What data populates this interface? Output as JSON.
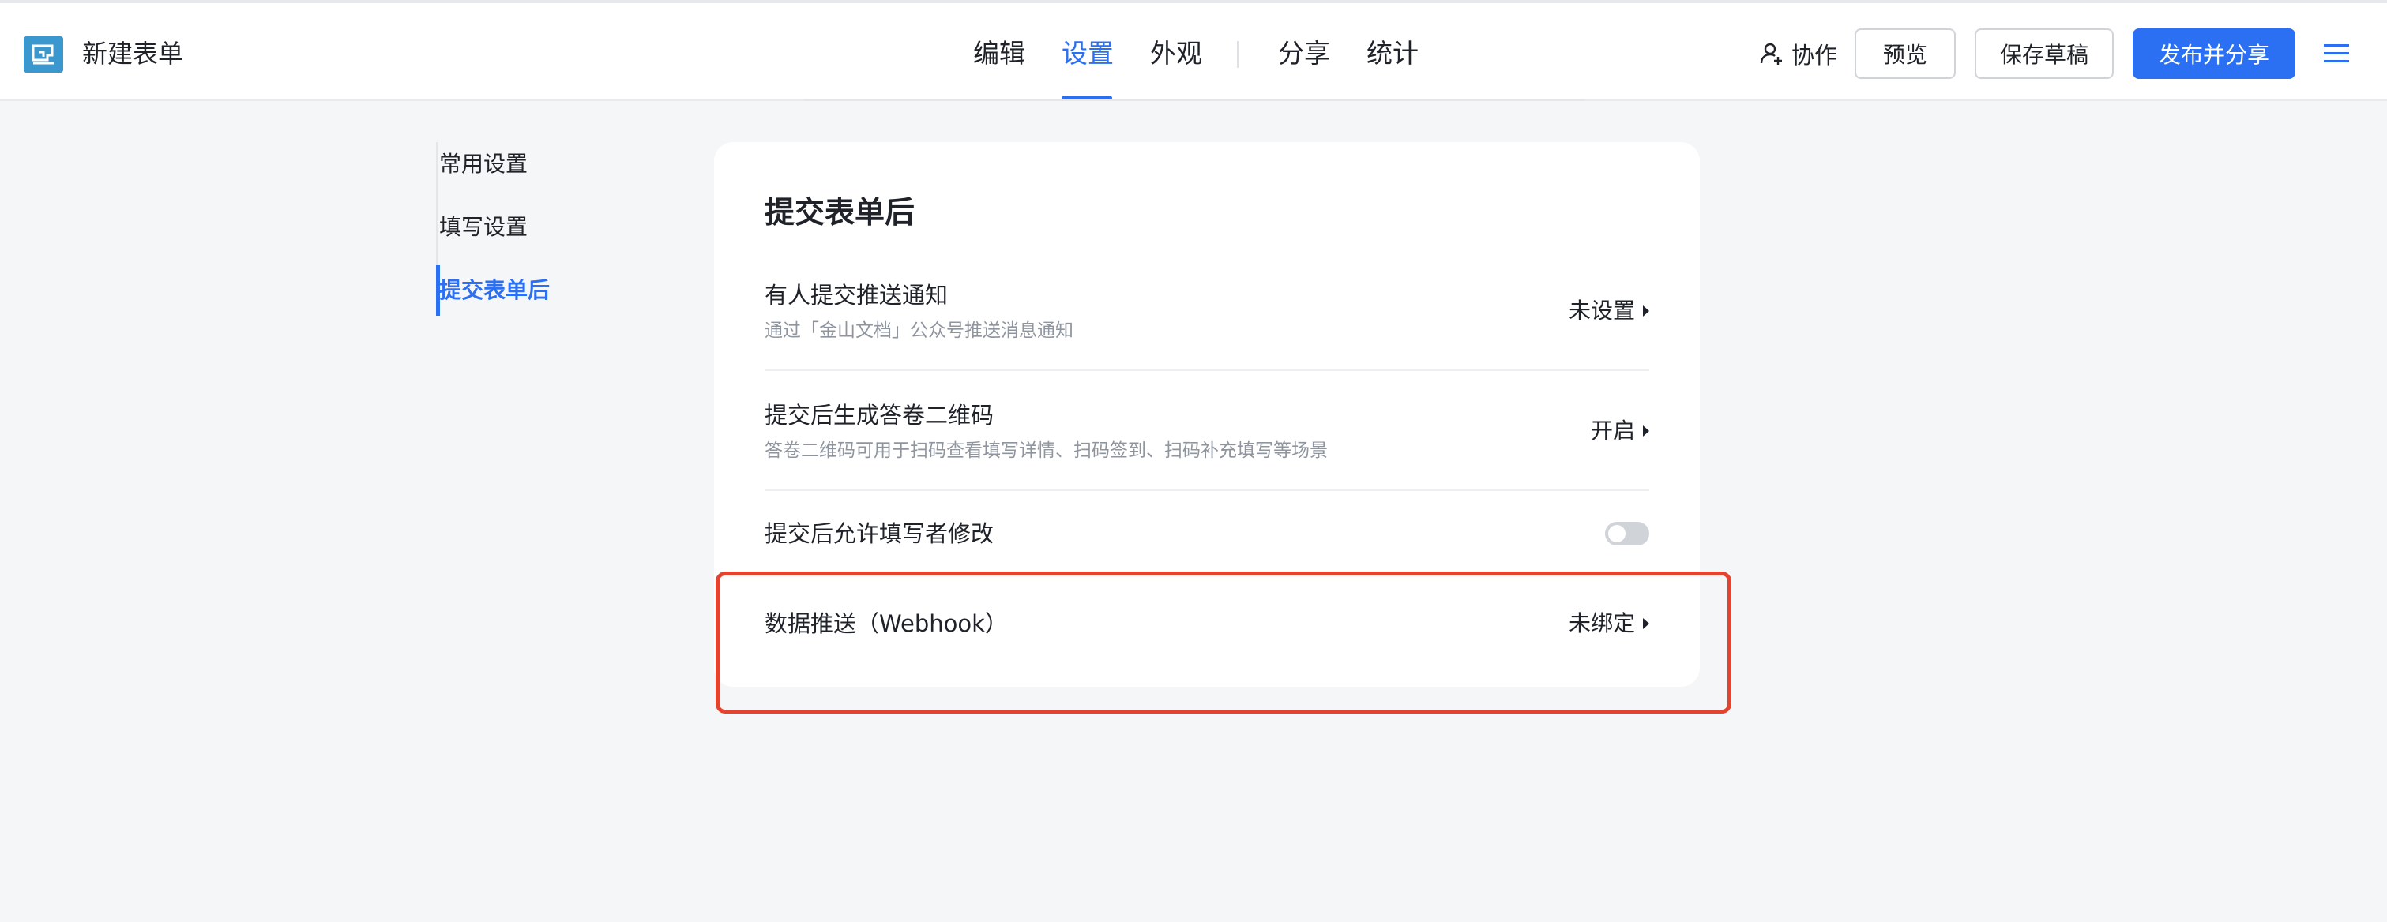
{
  "app": {
    "title": "新建表单",
    "logo_icon": "form-logo-icon"
  },
  "nav": {
    "tabs": [
      {
        "label": "编辑",
        "active": false
      },
      {
        "label": "设置",
        "active": true
      },
      {
        "label": "外观",
        "active": false
      },
      {
        "label": "分享",
        "active": false
      },
      {
        "label": "统计",
        "active": false
      }
    ]
  },
  "toolbar": {
    "collab_label": "协作",
    "preview_label": "预览",
    "save_draft_label": "保存草稿",
    "publish_label": "发布并分享",
    "menu_icon": "menu-icon"
  },
  "sidebar": {
    "items": [
      {
        "label": "常用设置",
        "active": false
      },
      {
        "label": "填写设置",
        "active": false
      },
      {
        "label": "提交表单后",
        "active": true
      }
    ]
  },
  "card": {
    "title": "提交表单后",
    "rows": [
      {
        "title": "有人提交推送通知",
        "desc": "通过「金山文档」公众号推送消息通知",
        "action": "未设置"
      },
      {
        "title": "提交后生成答卷二维码",
        "desc": "答卷二维码可用于扫码查看填写详情、扫码签到、扫码补充填写等场景",
        "action": "开启"
      },
      {
        "title": "提交后允许填写者修改",
        "toggle_on": false
      },
      {
        "title": "数据推送（Webhook）",
        "action": "未绑定"
      }
    ]
  },
  "colors": {
    "accent": "#2b6ff2",
    "highlight": "#e4442f"
  }
}
